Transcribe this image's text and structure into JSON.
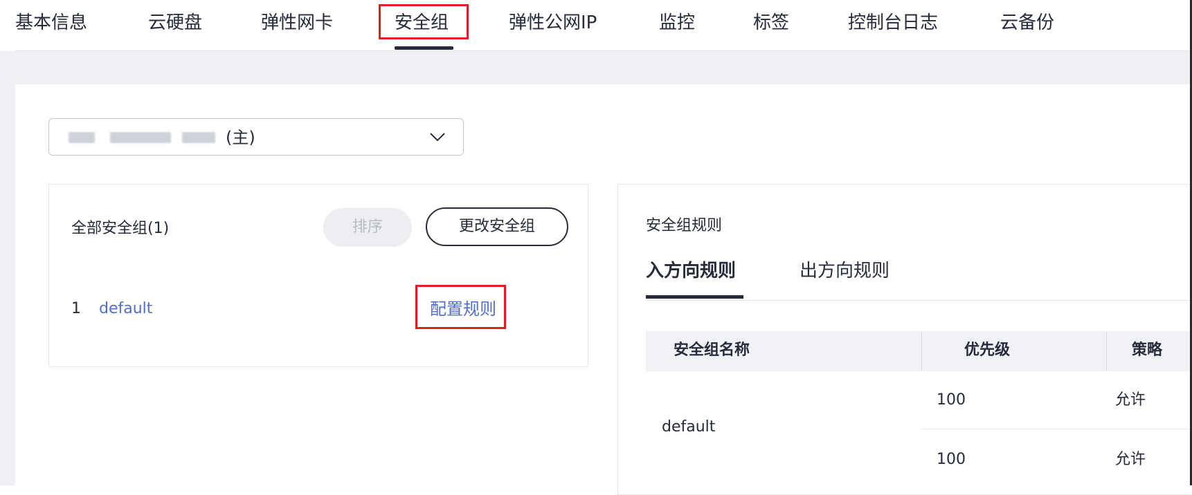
{
  "tabs": [
    {
      "label": "基本信息"
    },
    {
      "label": "云硬盘"
    },
    {
      "label": "弹性网卡"
    },
    {
      "label": "安全组",
      "active": true
    },
    {
      "label": "弹性公网IP"
    },
    {
      "label": "监控"
    },
    {
      "label": "标签"
    },
    {
      "label": "控制台日志"
    },
    {
      "label": "云备份"
    }
  ],
  "nic_select": {
    "suffix": "(主)"
  },
  "security_groups": {
    "title": "全部安全组(1)",
    "sort_button": "排序",
    "change_button": "更改安全组",
    "items": [
      {
        "index": "1",
        "name": "default",
        "action": "配置规则"
      }
    ]
  },
  "rules": {
    "title": "安全组规则",
    "tabs": [
      {
        "label": "入方向规则",
        "active": true
      },
      {
        "label": "出方向规则"
      }
    ],
    "columns": [
      "安全组名称",
      "优先级",
      "策略"
    ],
    "group_name": "default",
    "rows": [
      {
        "priority": "100",
        "policy": "允许"
      },
      {
        "priority": "100",
        "policy": "允许"
      }
    ]
  },
  "colors": {
    "link": "#526ecc",
    "highlight": "#e02020",
    "text": "#252b3a"
  }
}
